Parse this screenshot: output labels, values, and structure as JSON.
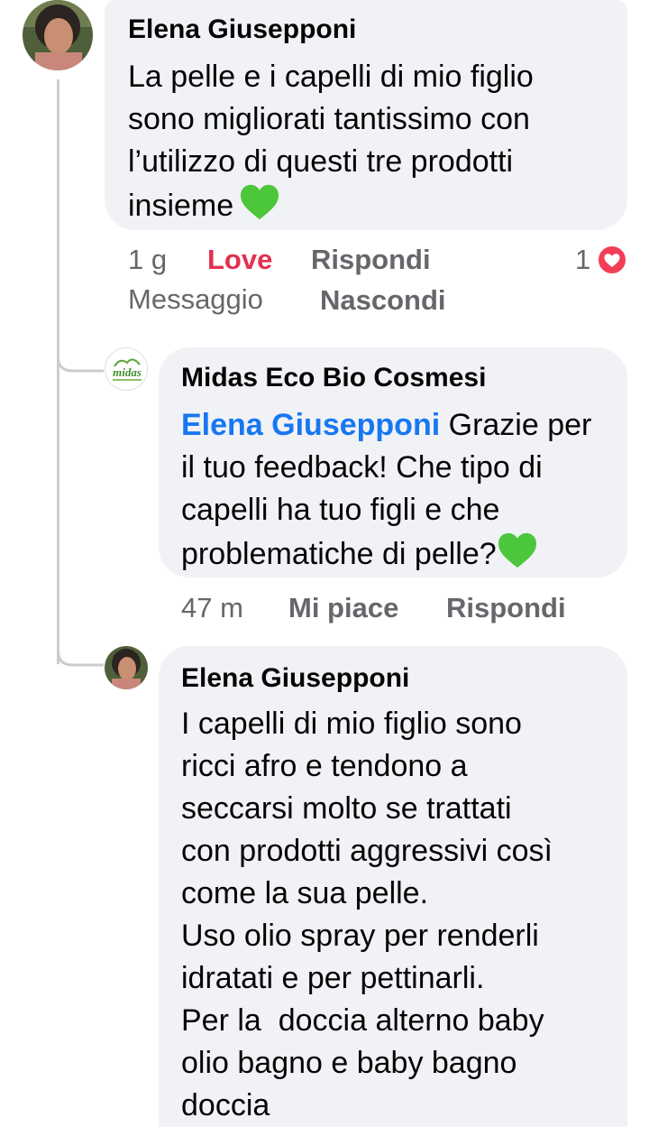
{
  "comments": [
    {
      "author": "Elena Giusepponi",
      "text_lines": [
        "La pelle e i capelli di mio figlio",
        "sono migliorati tantissimo con",
        "l’utilizzo di questi tre prodotti",
        "insieme"
      ],
      "time": "1 g",
      "reaction_label": "Love",
      "reply_label": "Rispondi",
      "message_label": "Messaggio",
      "hide_label": "Nascondi",
      "reaction_count": "1",
      "reaction_icon": "love-reaction-icon"
    },
    {
      "author": "Midas Eco Bio Cosmesi",
      "avatar_text": "midas",
      "mention": "Elena Giusepponi",
      "text_first": "Grazie per",
      "text_lines": [
        "il tuo feedback! Che tipo di",
        "capelli ha tuo figli e che",
        "problematiche di pelle?"
      ],
      "time": "47 m",
      "like_label": "Mi piace",
      "reply_label": "Rispondi"
    },
    {
      "author": "Elena Giusepponi",
      "text_lines": [
        "I capelli di mio figlio sono",
        "ricci afro e tendono a",
        "seccarsi molto se trattati",
        "con prodotti aggressivi così",
        "come la sua pelle.",
        "Uso olio spray per renderli",
        "idratati e per pettinarli.",
        "Per la  doccia alterno baby",
        "olio bagno e baby bagno",
        "doccia"
      ]
    }
  ],
  "colors": {
    "bubble": "#f0f2f5",
    "meta": "#65676b",
    "mention": "#1877f2",
    "love": "#e4304f",
    "green_heart": "#4cc63a"
  }
}
